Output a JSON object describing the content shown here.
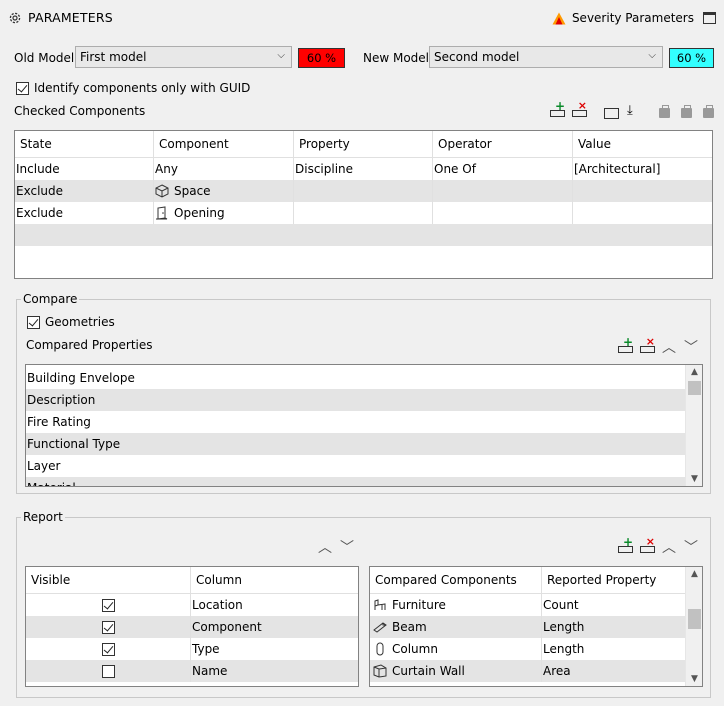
{
  "header": {
    "title": "PARAMETERS",
    "severity_label": "Severity Parameters"
  },
  "models": {
    "old_label": "Old Model",
    "old_value": "First model",
    "old_pct": "60 %",
    "old_color": "#ff0000",
    "new_label": "New Model",
    "new_value": "Second model",
    "new_pct": "60 %",
    "new_color": "#33ffff"
  },
  "guid_option": {
    "label": "Identify components only with GUID",
    "checked": true
  },
  "checked_components": {
    "title": "Checked Components",
    "columns": [
      "State",
      "Component",
      "Property",
      "Operator",
      "Value"
    ],
    "rows": [
      {
        "state": "Include",
        "component": "Any",
        "component_icon": "",
        "property": "Discipline",
        "operator": "One Of",
        "value": "[Architectural]"
      },
      {
        "state": "Exclude",
        "component": "Space",
        "component_icon": "cube-icon",
        "property": "",
        "operator": "",
        "value": ""
      },
      {
        "state": "Exclude",
        "component": "Opening",
        "component_icon": "opening-icon",
        "property": "",
        "operator": "",
        "value": ""
      }
    ]
  },
  "compare": {
    "legend": "Compare",
    "geometries_label": "Geometries",
    "compared_properties_label": "Compared Properties",
    "properties": [
      "Building Envelope",
      "Description",
      "Fire Rating",
      "Functional Type",
      "Layer",
      "Material"
    ]
  },
  "report": {
    "legend": "Report",
    "left_columns": [
      "Visible",
      "Column"
    ],
    "left_rows": [
      {
        "visible": true,
        "column": "Location"
      },
      {
        "visible": true,
        "column": "Component"
      },
      {
        "visible": true,
        "column": "Type"
      },
      {
        "visible": false,
        "column": "Name"
      }
    ],
    "right_columns": [
      "Compared Components",
      "Reported Property"
    ],
    "right_rows": [
      {
        "component": "Furniture",
        "icon": "furniture-icon",
        "property": "Count"
      },
      {
        "component": "Beam",
        "icon": "beam-icon",
        "property": "Length"
      },
      {
        "component": "Column",
        "icon": "column-icon",
        "property": "Length"
      },
      {
        "component": "Curtain Wall",
        "icon": "curtain-wall-icon",
        "property": "Area"
      }
    ]
  }
}
